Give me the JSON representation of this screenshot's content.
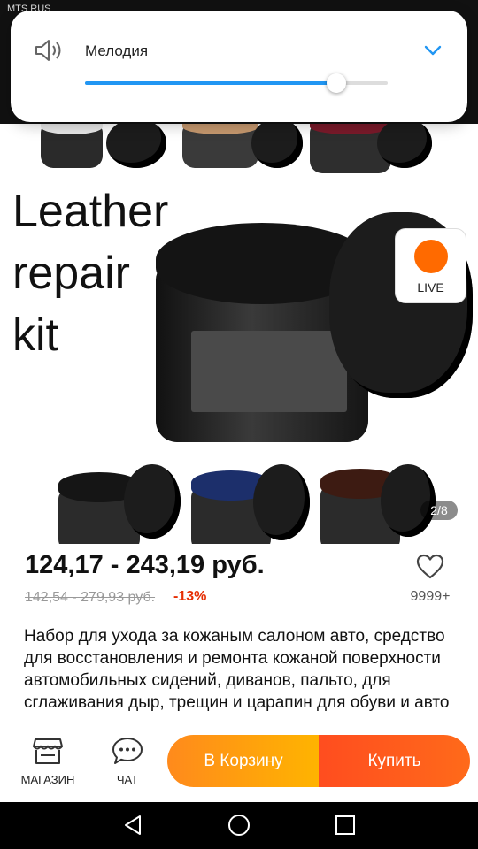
{
  "status_bar": {
    "carrier": "MTS RUS"
  },
  "volume_panel": {
    "label": "Мелодия",
    "level": 0.83,
    "icon": "speaker-icon",
    "expand_icon": "chevron-down-icon"
  },
  "gallery": {
    "headline_lines": [
      "Leather",
      "repair",
      "kit"
    ],
    "page_indicator": "2/8",
    "live_label": "LIVE"
  },
  "product": {
    "price_range": "124,17 - 243,19 руб.",
    "old_price_range": "142,54 - 279,93 руб.",
    "discount": "-13%",
    "favorites_count": "9999+",
    "description": "Набор для ухода за кожаным салоном авто, средство для восстановления и ремонта кожаной поверхности автомобильных сидений, диванов, пальто, для сглаживания дыр, трещин и царапин для обуви и авто"
  },
  "action_bar": {
    "shop_label": "МАГАЗИН",
    "chat_label": "ЧАТ",
    "cart_label": "В Корзину",
    "buy_label": "Купить"
  },
  "colors": {
    "accent_blue": "#2196f3",
    "cart_orange": "#ffa10e",
    "buy_red": "#ff5a1f",
    "discount_red": "#e62e04"
  }
}
